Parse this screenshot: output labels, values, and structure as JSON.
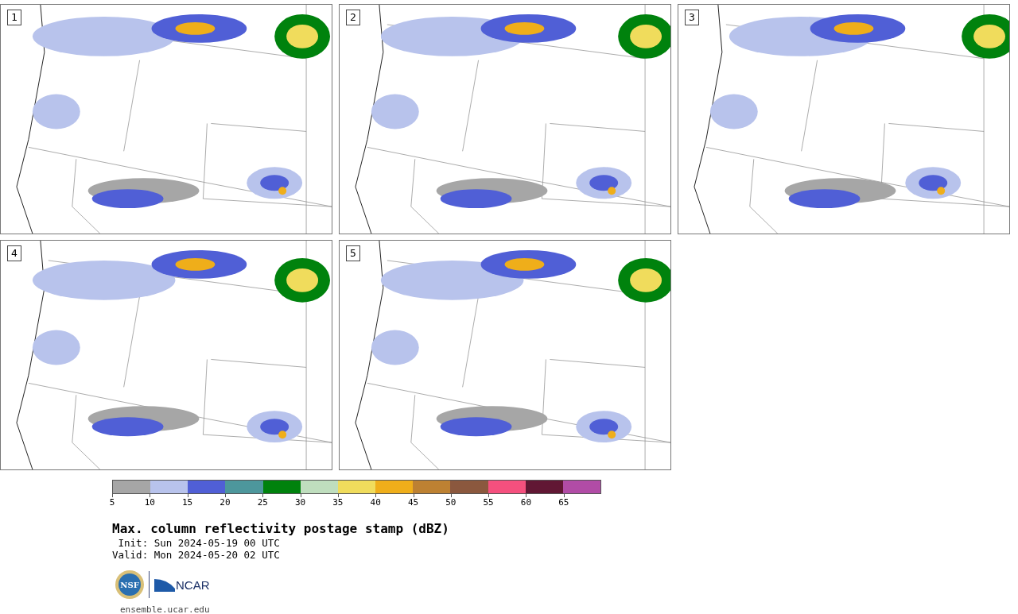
{
  "panels": [
    {
      "label": "1"
    },
    {
      "label": "2"
    },
    {
      "label": "3"
    },
    {
      "label": "4"
    },
    {
      "label": "5"
    }
  ],
  "colorbar": {
    "segments": [
      {
        "color": "#a6a6a6"
      },
      {
        "color": "#b8c3ec"
      },
      {
        "color": "#505fd6"
      },
      {
        "color": "#4d979c"
      },
      {
        "color": "#00820d"
      },
      {
        "color": "#bfdebe"
      },
      {
        "color": "#f0dc5c"
      },
      {
        "color": "#efae1a"
      },
      {
        "color": "#bd8132"
      },
      {
        "color": "#8b583e"
      },
      {
        "color": "#f5507e"
      },
      {
        "color": "#611734"
      },
      {
        "color": "#b14ca6"
      }
    ],
    "ticks": [
      "5",
      "10",
      "15",
      "20",
      "25",
      "30",
      "35",
      "40",
      "45",
      "50",
      "55",
      "60",
      "65"
    ]
  },
  "title": "Max. column reflectivity postage stamp (dBZ)",
  "init": " Init: Sun 2024-05-19 00 UTC",
  "valid": "Valid: Mon 2024-05-20 02 UTC",
  "logos": {
    "seal_text": "NSF",
    "org_text": "NCAR"
  },
  "site": "ensemble.ucar.edu"
}
